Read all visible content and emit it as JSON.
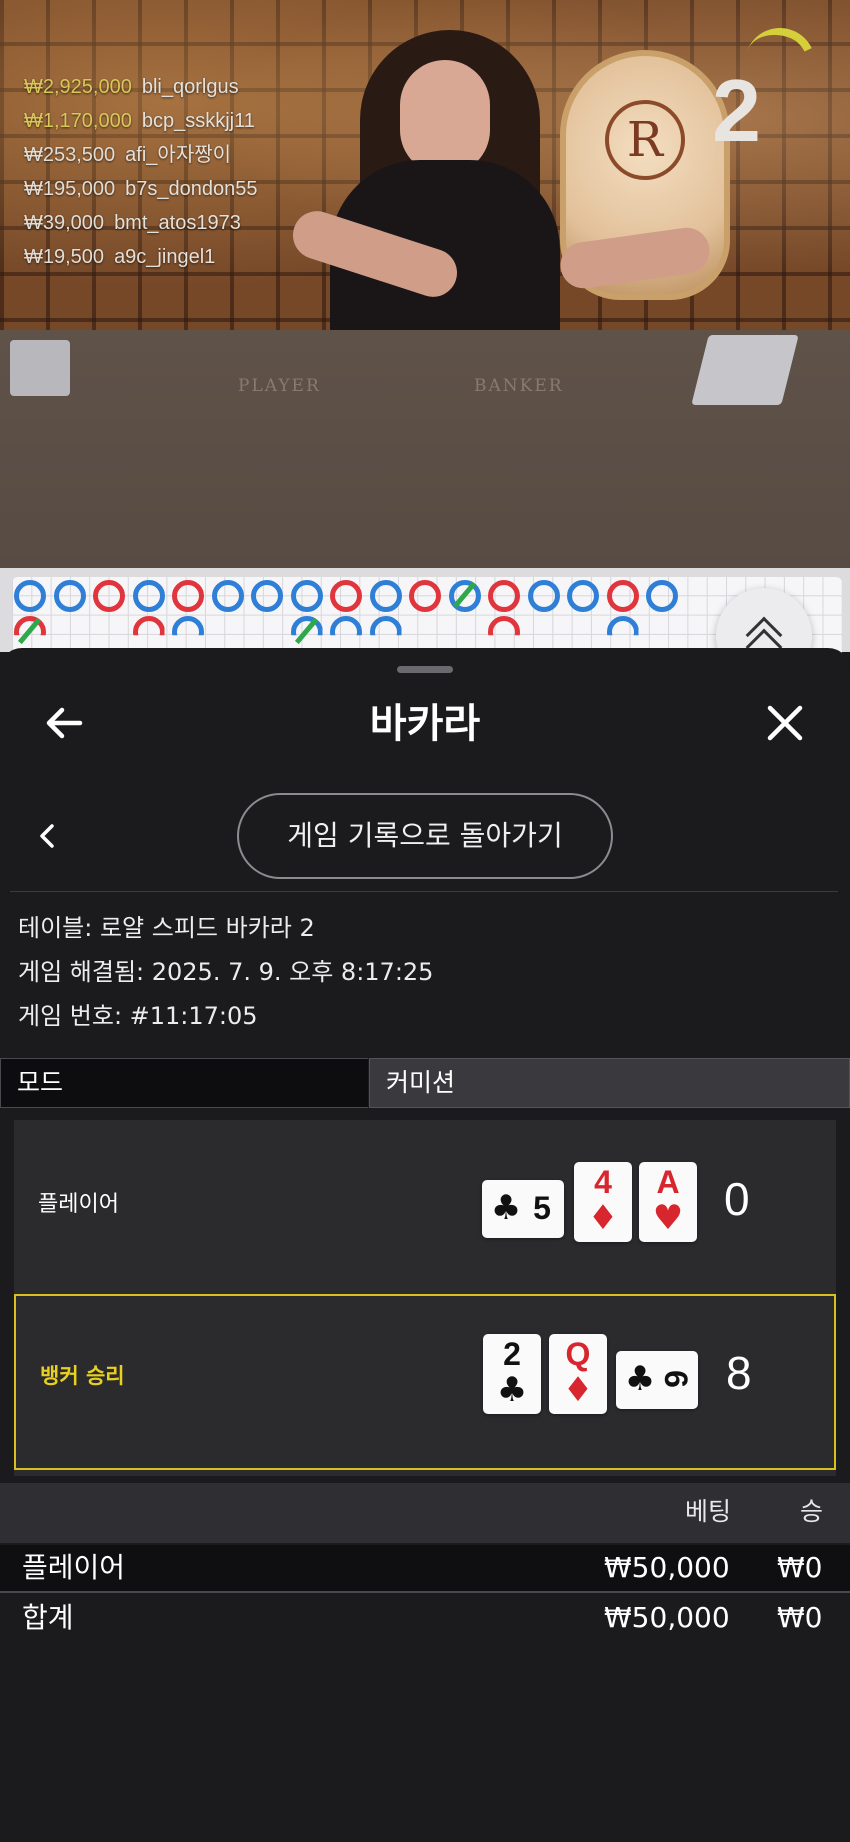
{
  "stream": {
    "round_number": "2",
    "table_labels": {
      "player": "PLAYER",
      "banker": "BANKER"
    },
    "leaderboard": [
      {
        "amount": "₩2,925,000",
        "name": "bli_qorlgus"
      },
      {
        "amount": "₩1,170,000",
        "name": "bcp_sskkjj11"
      },
      {
        "amount": "₩253,500",
        "name": "afi_아자짱이"
      },
      {
        "amount": "₩195,000",
        "name": "b7s_dondon55"
      },
      {
        "amount": "₩39,000",
        "name": "bmt_atos1973"
      },
      {
        "amount": "₩19,500",
        "name": "a9c_jingel1"
      }
    ]
  },
  "roadmap": {
    "colors": {
      "player": "#2f7fd6",
      "banker": "#e0353d",
      "tie": "#2ea84a"
    },
    "row1": [
      "P",
      "P",
      "B",
      "P",
      "B",
      "P",
      "P",
      "P",
      "B",
      "P",
      "B",
      "P",
      "B",
      "P",
      "P",
      "B",
      "P"
    ],
    "row2": [
      "B",
      "B",
      "P",
      "P",
      "P",
      "P",
      "B",
      "P"
    ]
  },
  "sheet": {
    "title": "바카라",
    "back_icon": "arrow-left-icon",
    "close_icon": "close-x-icon",
    "return_button": "게임 기록으로 돌아가기",
    "info": {
      "table": "테이블: 로얄 스피드 바카라 2",
      "resolved": "게임 해결됨: 2025. 7. 9. 오후 8:17:25",
      "game_no": "게임 번호: #11:17:05"
    },
    "tabs": {
      "mode": "모드",
      "commission": "커미션"
    },
    "hands": {
      "player": {
        "label": "플레이어",
        "score": "0",
        "cards": [
          {
            "rank": "5",
            "suit": "♣",
            "color": "#111111",
            "rotated": true
          },
          {
            "rank": "4",
            "suit": "♦",
            "color": "#d8262e"
          },
          {
            "rank": "A",
            "suit": "♥",
            "color": "#d8262e"
          }
        ]
      },
      "banker": {
        "label": "뱅커 승리",
        "score": "8",
        "highlight": "#d8c020",
        "cards": [
          {
            "rank": "2",
            "suit": "♣",
            "color": "#111111"
          },
          {
            "rank": "Q",
            "suit": "♦",
            "color": "#d8262e"
          },
          {
            "rank": "6",
            "suit": "♣",
            "color": "#111111",
            "rotated": true
          }
        ]
      }
    },
    "bets": {
      "headers": {
        "bet": "베팅",
        "win": "승"
      },
      "rows": [
        {
          "label": "플레이어",
          "bet": "₩50,000",
          "win": "₩0"
        },
        {
          "label": "합계",
          "bet": "₩50,000",
          "win": "₩0"
        }
      ]
    }
  }
}
